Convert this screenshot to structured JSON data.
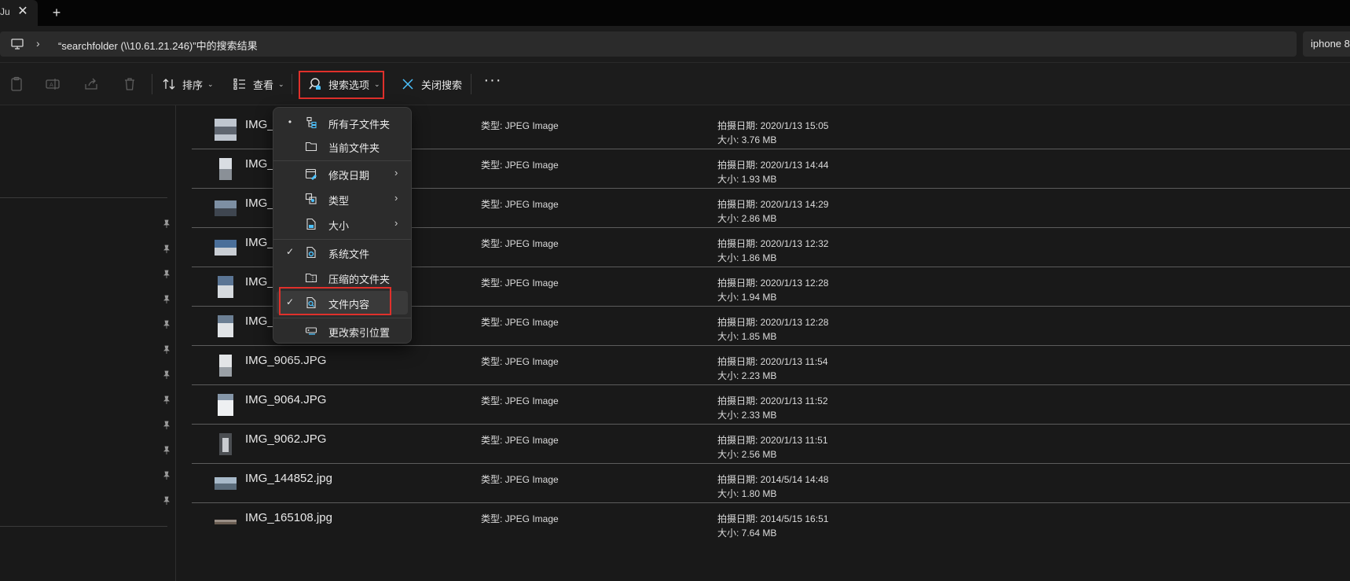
{
  "window": {
    "tab_title": "Ju",
    "tab_close": "✕",
    "tab_add": "+"
  },
  "address": {
    "chevron": "›",
    "path": "“searchfolder (\\\\10.61.21.246)”中的搜索结果",
    "search_value": "iphone 8"
  },
  "toolbar": {
    "sort_label": "排序",
    "view_label": "查看",
    "search_options_label": "搜索选项",
    "close_search_label": "关闭搜索",
    "more_label": "···",
    "caret": "⌄"
  },
  "menu": {
    "items": [
      {
        "label": "所有子文件夹",
        "mark": "•",
        "icon": "subfolders-icon"
      },
      {
        "label": "当前文件夹",
        "mark": "",
        "icon": "folder-icon"
      },
      {
        "label": "修改日期",
        "mark": "",
        "icon": "calendar-edit-icon",
        "sub": "›"
      },
      {
        "label": "类型",
        "mark": "",
        "icon": "type-icon",
        "sub": "›"
      },
      {
        "label": "大小",
        "mark": "",
        "icon": "size-icon",
        "sub": "›"
      },
      {
        "label": "系统文件",
        "mark": "✓",
        "icon": "system-file-icon"
      },
      {
        "label": "压缩的文件夹",
        "mark": "",
        "icon": "zip-folder-icon"
      },
      {
        "label": "文件内容",
        "mark": "✓",
        "icon": "file-content-search-icon"
      },
      {
        "label": "更改索引位置",
        "mark": "",
        "icon": "index-location-icon"
      }
    ]
  },
  "files": [
    {
      "name": "IMG_",
      "type": "类型: JPEG Image",
      "date": "拍摄日期: 2020/1/13 15:05",
      "size": "大小: 3.76 MB"
    },
    {
      "name": "IMG_",
      "type": "类型: JPEG Image",
      "date": "拍摄日期: 2020/1/13 14:44",
      "size": "大小: 1.93 MB"
    },
    {
      "name": "IMG_",
      "type": "类型: JPEG Image",
      "date": "拍摄日期: 2020/1/13 14:29",
      "size": "大小: 2.86 MB"
    },
    {
      "name": "IMG_",
      "type": "类型: JPEG Image",
      "date": "拍摄日期: 2020/1/13 12:32",
      "size": "大小: 1.86 MB"
    },
    {
      "name": "IMG_",
      "type": "类型: JPEG Image",
      "date": "拍摄日期: 2020/1/13 12:28",
      "size": "大小: 1.94 MB"
    },
    {
      "name": "IMG_",
      "type": "类型: JPEG Image",
      "date": "拍摄日期: 2020/1/13 12:28",
      "size": "大小: 1.85 MB"
    },
    {
      "name": "IMG_9065.JPG",
      "type": "类型: JPEG Image",
      "date": "拍摄日期: 2020/1/13 11:54",
      "size": "大小: 2.23 MB"
    },
    {
      "name": "IMG_9064.JPG",
      "type": "类型: JPEG Image",
      "date": "拍摄日期: 2020/1/13 11:52",
      "size": "大小: 2.33 MB"
    },
    {
      "name": "IMG_9062.JPG",
      "type": "类型: JPEG Image",
      "date": "拍摄日期: 2020/1/13 11:51",
      "size": "大小: 2.56 MB"
    },
    {
      "name": "IMG_144852.jpg",
      "type": "类型: JPEG Image",
      "date": "拍摄日期: 2014/5/14 14:48",
      "size": "大小: 1.80 MB"
    },
    {
      "name": "IMG_165108.jpg",
      "type": "类型: JPEG Image",
      "date": "拍摄日期: 2014/5/15 16:51",
      "size": "大小: 7.64 MB"
    }
  ],
  "colors": {
    "background": "#191919",
    "highlight_border": "#e0302b",
    "accent_icon": "#4cc2ff"
  }
}
